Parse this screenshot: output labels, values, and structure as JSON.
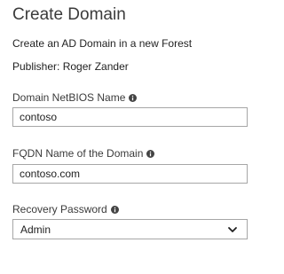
{
  "header": {
    "title": "Create Domain",
    "description": "Create an AD Domain in a new Forest",
    "publisher": "Publisher: Roger Zander"
  },
  "fields": {
    "netbios": {
      "label": "Domain NetBIOS Name",
      "value": "contoso",
      "info_icon": "info-icon"
    },
    "fqdn": {
      "label": "FQDN Name of the Domain",
      "value": "contoso.com",
      "info_icon": "info-icon"
    },
    "recovery": {
      "label": "Recovery Password",
      "selected": "Admin",
      "info_icon": "info-icon",
      "dropdown_icon": "chevron-down-icon"
    }
  },
  "colors": {
    "text": "#1f1f1f",
    "label": "#3b3b3b",
    "border": "#a6a6a6",
    "icon": "#444444"
  }
}
